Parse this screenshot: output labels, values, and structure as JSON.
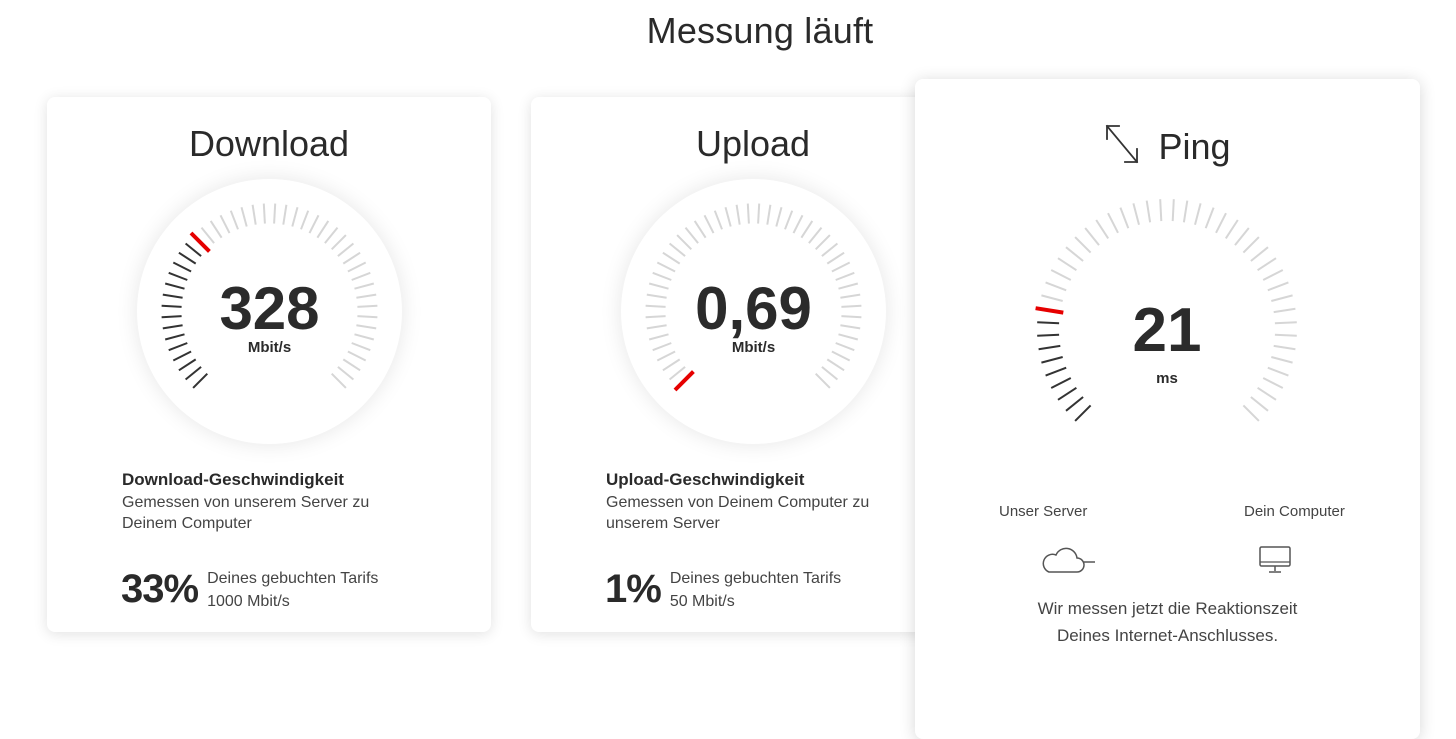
{
  "page": {
    "title": "Messung läuft"
  },
  "accent_color": "#e60000",
  "download": {
    "title": "Download",
    "value": "328",
    "unit": "Mbit/s",
    "level": 0.33,
    "heading": "Download-Geschwindigkeit",
    "description_line1": "Gemessen von unserem Server zu",
    "description_line2": "Deinem Computer",
    "percent": "33%",
    "percent_label": "Deines gebuchten Tarifs",
    "tariff": "1000 Mbit/s"
  },
  "upload": {
    "title": "Upload",
    "value": "0,69",
    "unit": "Mbit/s",
    "level": 0.01,
    "heading": "Upload-Geschwindigkeit",
    "description_line1": "Gemessen von Deinem Computer zu",
    "description_line2": "unserem Server",
    "percent": "1%",
    "percent_label": "Deines gebuchten Tarifs",
    "tariff": "50 Mbit/s"
  },
  "ping": {
    "title": "Ping",
    "icon": "expand-arrows-icon",
    "value": "21",
    "unit": "ms",
    "level": 0.2,
    "server_label": "Unser Server",
    "server_icon": "cloud-icon",
    "computer_label": "Dein Computer",
    "computer_icon": "monitor-icon",
    "message_line1": "Wir messen jetzt die Reaktionszeit",
    "message_line2": "Deines Internet-Anschlusses."
  }
}
